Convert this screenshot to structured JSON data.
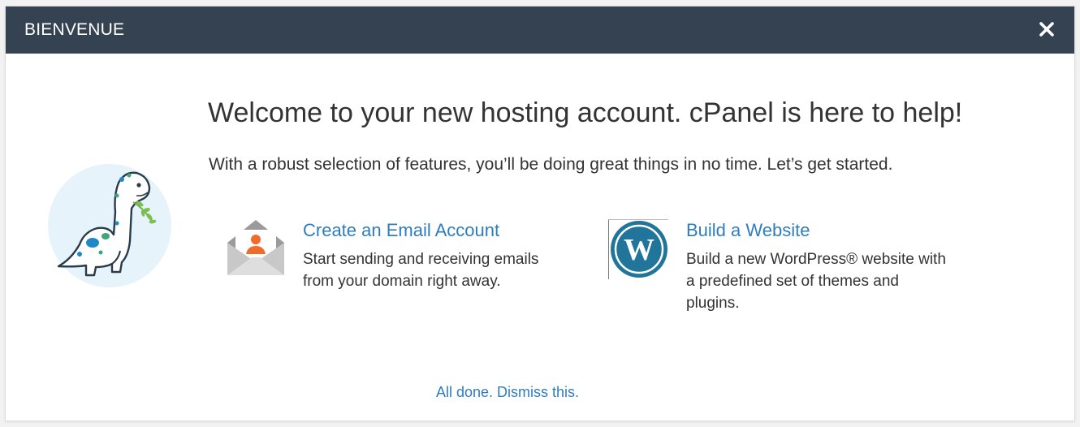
{
  "modal": {
    "title": "BIENVENUE",
    "close_icon": "close-icon"
  },
  "main": {
    "headline": "Welcome to your new hosting account. cPanel is here to help!",
    "subline": "With a robust selection of features, you’ll be doing great things in no time. Let’s get started."
  },
  "features": [
    {
      "icon": "email-envelope-icon",
      "link": "Create an Email Account",
      "description": "Start sending and receiving emails from your domain right away."
    },
    {
      "icon": "wordpress-icon",
      "link": "Build a Website",
      "description": "Build a new WordPress® website with a predefined set of themes and plugins."
    }
  ],
  "footer": {
    "dismiss": "All done. Dismiss this."
  },
  "colors": {
    "header_bg": "#344252",
    "link": "#2e7dc1",
    "text": "#333333",
    "wordpress_blue": "#21759b",
    "email_orange": "#f26b2b",
    "mascot_bg": "#e6f3fb"
  }
}
